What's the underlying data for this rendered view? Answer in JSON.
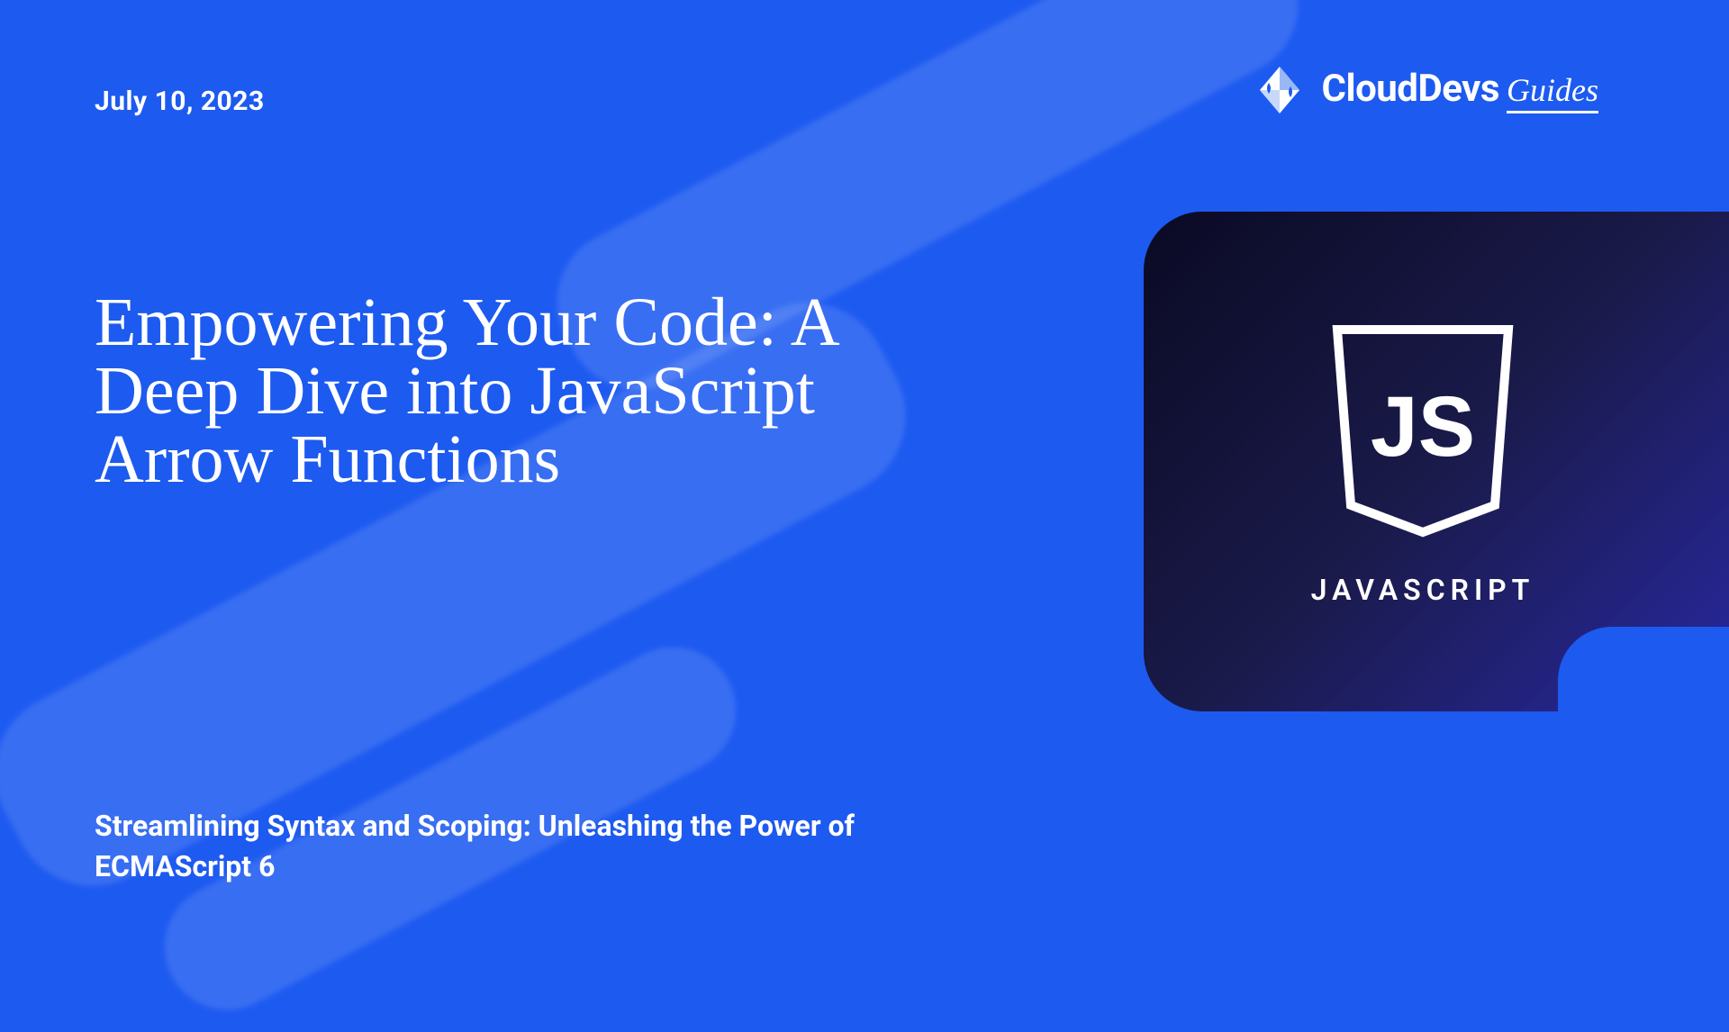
{
  "date": "July 10,  2023",
  "brand": {
    "name": "CloudDevs",
    "suffix": "Guides"
  },
  "title": "Empowering Your Code: A Deep Dive into JavaScript Arrow Functions",
  "subtitle": "Streamlining Syntax and Scoping: Unleashing the Power of ECMAScript 6",
  "card": {
    "shield_text": "JS",
    "label": "JAVASCRIPT"
  }
}
